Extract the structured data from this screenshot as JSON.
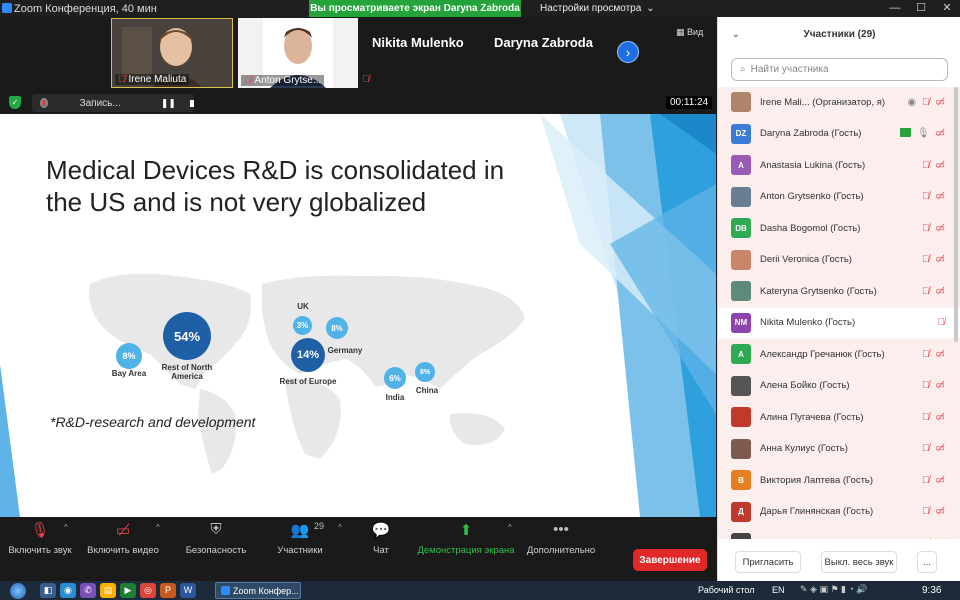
{
  "window": {
    "title": "Zoom Конференция, 40 мин",
    "viewing_banner": "Вы просматриваете экран Daryna Zabroda",
    "view_options": "Настройки просмотра",
    "view_button": "Вид"
  },
  "video_strip": {
    "tiles": [
      {
        "label": "Irene Maliuta"
      },
      {
        "label": "Anton Grytse..."
      }
    ],
    "name_tiles": [
      "Nikita Mulenko",
      "Daryna Zabroda"
    ]
  },
  "recording": {
    "label": "Запись...",
    "timer": "00:11:24"
  },
  "slide": {
    "title_line1": "Medical Devices R&D is consolidated in",
    "title_line2": "the US and is not very globalized",
    "footnote": "*R&D-research and development",
    "bubbles": [
      {
        "value": "8%",
        "label": "Bay Area"
      },
      {
        "value": "54%",
        "label": "Rest of North America"
      },
      {
        "value": "3%",
        "label": "UK"
      },
      {
        "value": "8%",
        "label": "Germany"
      },
      {
        "value": "14%",
        "label": "Rest of Europe"
      },
      {
        "value": "6%",
        "label": "India"
      },
      {
        "value": "8%",
        "label": "China"
      }
    ]
  },
  "toolbar": {
    "mic": "Включить звук",
    "video": "Включить видео",
    "security": "Безопасность",
    "participants": "Участники",
    "participants_count": "29",
    "chat": "Чат",
    "share": "Демонстрация экрана",
    "more": "Дополнительно",
    "end": "Завершение"
  },
  "panel": {
    "title": "Участники (29)",
    "search_placeholder": "Найти участника",
    "invite": "Пригласить",
    "mute_all": "Выкл. весь звук",
    "more": "...",
    "participants": [
      {
        "name": "Irene Mali...  (Организатор, я)",
        "avatar": "",
        "avatar_color": "#b0846a",
        "state": "host"
      },
      {
        "name": "Daryna Zabroda (Гость)",
        "avatar": "DZ",
        "avatar_color": "#3a7bd5",
        "state": "sharing"
      },
      {
        "name": "Anastasia Lukina (Гость)",
        "avatar": "A",
        "avatar_color": "#9b59b6",
        "state": "muted"
      },
      {
        "name": "Anton Grytsenko (Гость)",
        "avatar": "",
        "avatar_color": "#6a7d92",
        "state": "muted"
      },
      {
        "name": "Dasha Bogomol (Гость)",
        "avatar": "DB",
        "avatar_color": "#2eaa52",
        "state": "muted"
      },
      {
        "name": "Derii Veronica (Гость)",
        "avatar": "",
        "avatar_color": "#c9876a",
        "state": "muted"
      },
      {
        "name": "Kateryna Grytsenko (Гость)",
        "avatar": "",
        "avatar_color": "#5d8a7a",
        "state": "muted"
      },
      {
        "name": "Nikita Mulenko (Гость)",
        "avatar": "NM",
        "avatar_color": "#8e44ad",
        "state": "mic-only"
      },
      {
        "name": "Александр Гречанюк (Гость)",
        "avatar": "А",
        "avatar_color": "#2eaa52",
        "state": "muted"
      },
      {
        "name": "Алена Бойко (Гость)",
        "avatar": "",
        "avatar_color": "#555",
        "state": "muted"
      },
      {
        "name": "Алина Пугачева (Гость)",
        "avatar": "",
        "avatar_color": "#c0392b",
        "state": "muted"
      },
      {
        "name": "Анна Кулиус (Гость)",
        "avatar": "",
        "avatar_color": "#7d5a50",
        "state": "muted"
      },
      {
        "name": "Виктория Лаптева (Гость)",
        "avatar": "В",
        "avatar_color": "#e67e22",
        "state": "muted"
      },
      {
        "name": "Дарья Глинянская (Гость)",
        "avatar": "Д",
        "avatar_color": "#c0392b",
        "state": "muted"
      },
      {
        "name": "Дарья Демко (Гость)",
        "avatar": "",
        "avatar_color": "#444",
        "state": "muted"
      }
    ]
  },
  "taskbar": {
    "zoom_task": "Zoom Конфер...",
    "desktop": "Рабочий стол",
    "lang": "EN",
    "clock": "9:36"
  }
}
